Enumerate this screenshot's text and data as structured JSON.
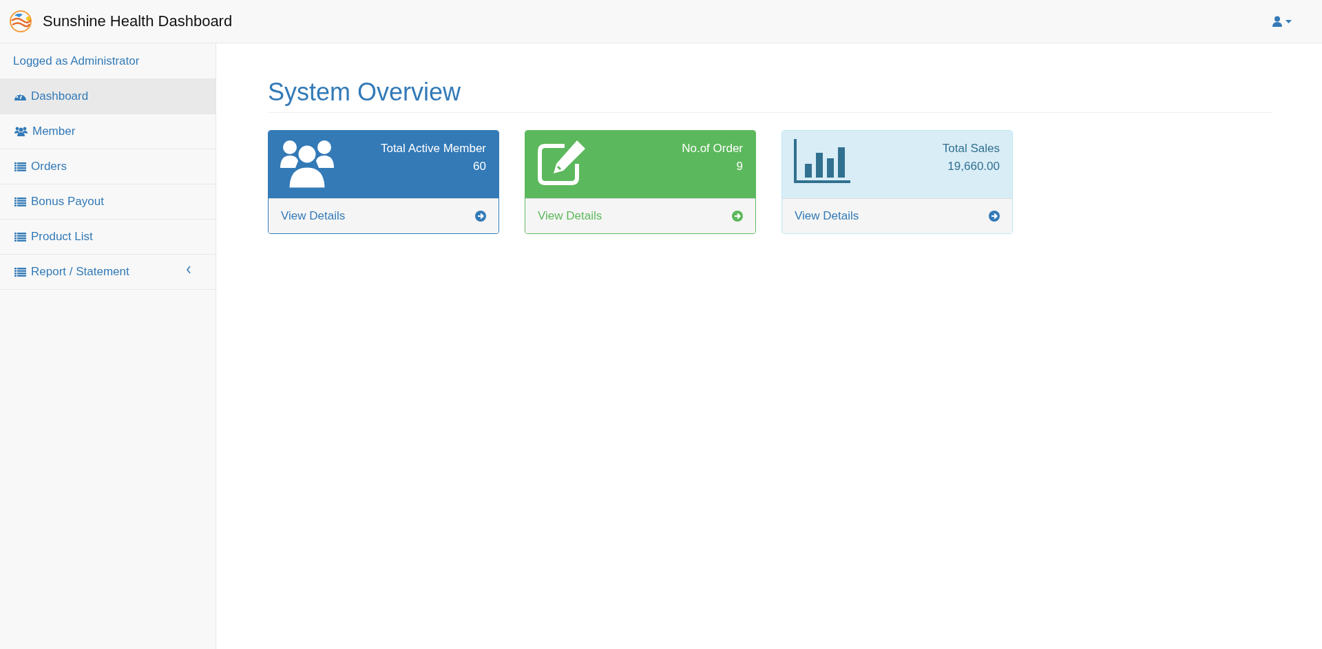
{
  "header": {
    "title": "Sunshine Health Dashboard"
  },
  "sidebar": {
    "user_label": "Logged as Administrator",
    "items": [
      {
        "label": "Dashboard",
        "kind": "dashboard",
        "selected": true,
        "expandable": false
      },
      {
        "label": "Member",
        "kind": "users",
        "selected": false,
        "expandable": false
      },
      {
        "label": "Orders",
        "kind": "list",
        "selected": false,
        "expandable": false
      },
      {
        "label": "Bonus Payout",
        "kind": "list",
        "selected": false,
        "expandable": false
      },
      {
        "label": "Product List",
        "kind": "list",
        "selected": false,
        "expandable": false
      },
      {
        "label": "Report / Statement",
        "kind": "list",
        "selected": false,
        "expandable": true
      }
    ]
  },
  "page": {
    "heading": "System Overview"
  },
  "panels": [
    {
      "kind": "primary",
      "title": "Total Active Member",
      "value": "60",
      "link": "View Details"
    },
    {
      "kind": "success",
      "title": "No.of Order",
      "value": "9",
      "link": "View Details"
    },
    {
      "kind": "info",
      "title": "Total Sales",
      "value": "19,660.00",
      "link": "View Details"
    }
  ]
}
